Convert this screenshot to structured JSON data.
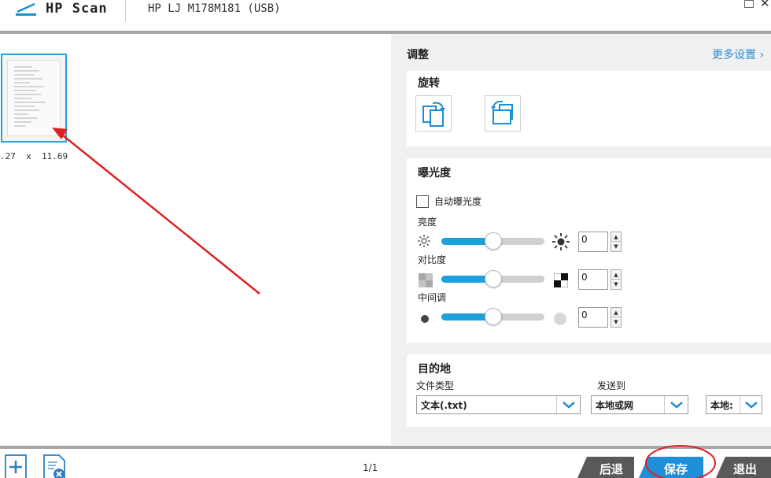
{
  "header": {
    "app_title": "HP Scan",
    "device_name": "HP LJ M178M181 (USB)"
  },
  "preview": {
    "page_size": ".27  x  11.69"
  },
  "panel": {
    "title": "调整",
    "more_settings": "更多设置",
    "rotate": {
      "title": "旋转"
    },
    "exposure": {
      "title": "曝光度",
      "auto_label": "自动曝光度",
      "auto_checked": false,
      "brightness": {
        "label": "亮度",
        "value": "0",
        "level": 0.5
      },
      "contrast": {
        "label": "对比度",
        "value": "0",
        "level": 0.5
      },
      "midtone": {
        "label": "中间调",
        "value": "0",
        "level": 0.5
      }
    },
    "destination": {
      "title": "目的地",
      "file_type_label": "文件类型",
      "file_type_value": "文本(.txt)",
      "send_to_label": "发送到",
      "send_to_value": "本地或网",
      "third_value": "本地:"
    }
  },
  "footer": {
    "page_counter": "1/1",
    "back": "后退",
    "save": "保存",
    "exit": "退出"
  },
  "colors": {
    "accent": "#1da1dd",
    "save_button": "#1e8fd8",
    "dark_button": "#595959",
    "annotation": "#e02020"
  }
}
